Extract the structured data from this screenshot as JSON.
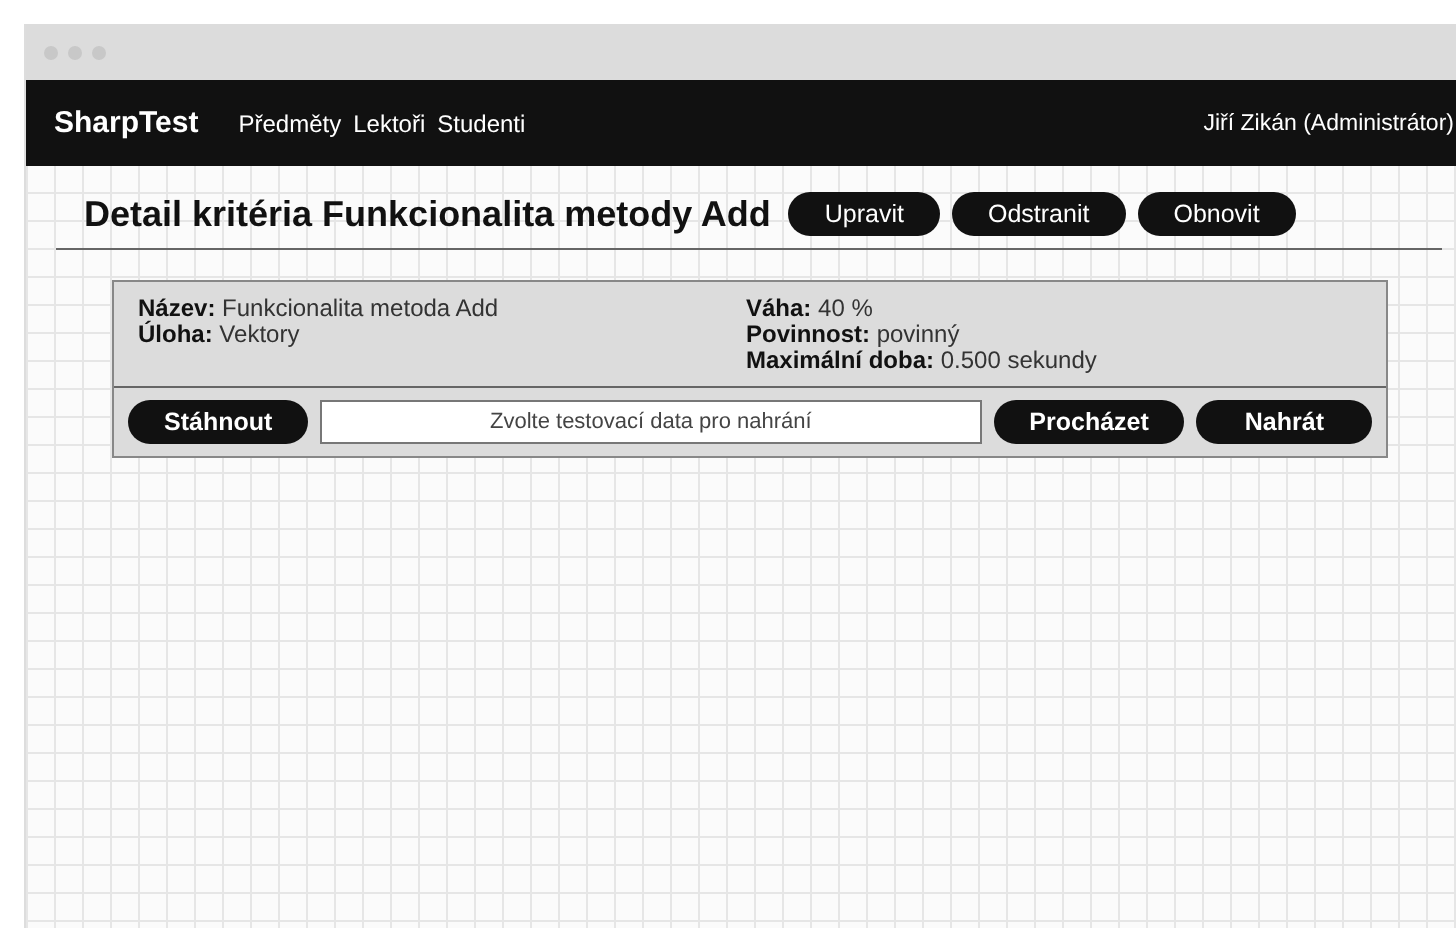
{
  "brand": "SharpTest",
  "nav": [
    "Předměty",
    "Lektoři",
    "Studenti"
  ],
  "user": "Jiří Zikán (Administrátor)",
  "title": "Detail kritéria Funkcionalita metody Add",
  "actions": [
    "Upravit",
    "Odstranit",
    "Obnovit"
  ],
  "details_left": [
    "**Název:** Funkcionalita metoda Add",
    "**Úloha:** Vektory"
  ],
  "details_right": [
    "**Váha:** 40 %",
    "**Povinnost:** povinný",
    "**Maximální doba:** 0.500 sekundy"
  ],
  "download": "Stáhnout",
  "file_field": {
    "placeholder": "Zvolte testovací data pro nahrání"
  },
  "browse": "Procházet",
  "upload": "Nahrát"
}
